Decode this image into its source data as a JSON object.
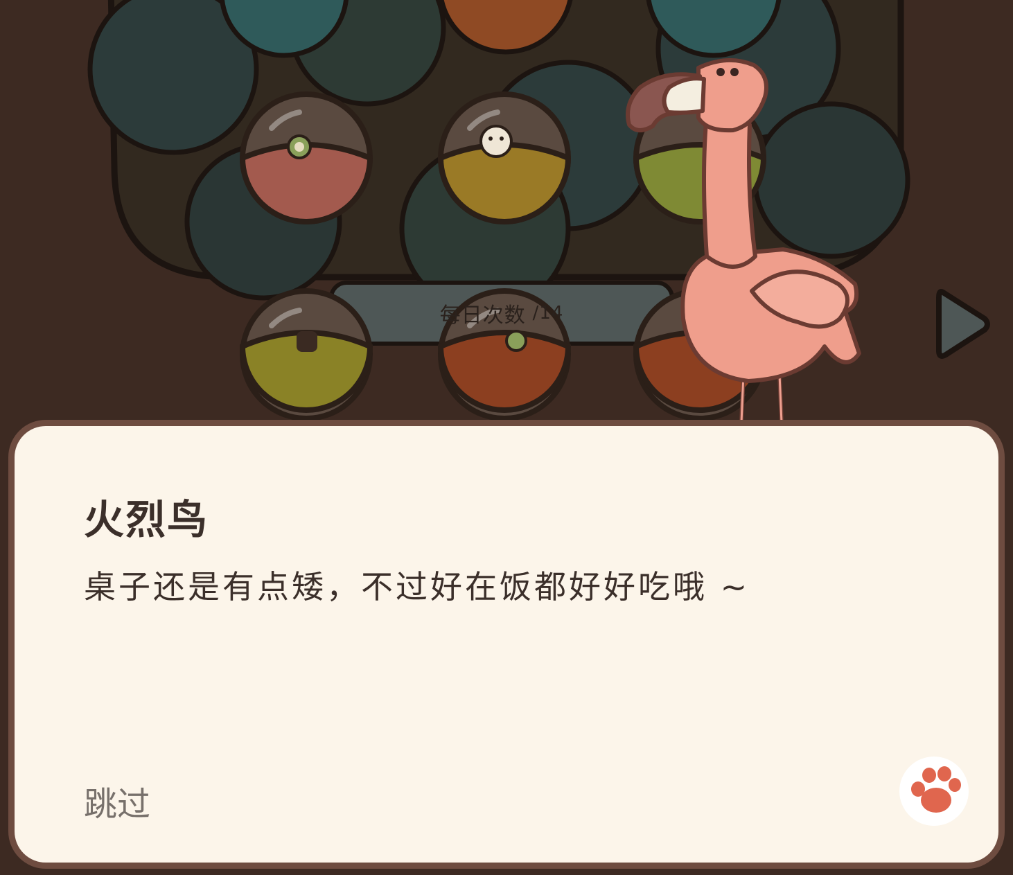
{
  "hud": {
    "counter_label": "每日次数",
    "counter_value": "/14"
  },
  "dialog": {
    "speaker": "火烈鸟",
    "line": "桌子还是有点矮，不过好在饭都好好吃哦 ~",
    "skip_label": "跳过"
  },
  "icons": {
    "next": "triangle-right-icon",
    "advance": "paw-icon"
  },
  "colors": {
    "dialog_bg": "#fcf5ea",
    "dialog_border": "#6e4c40",
    "text_primary": "#3b2f2a",
    "text_secondary": "#77706b",
    "flamingo": "#f0a090",
    "paw": "#e0664e"
  }
}
